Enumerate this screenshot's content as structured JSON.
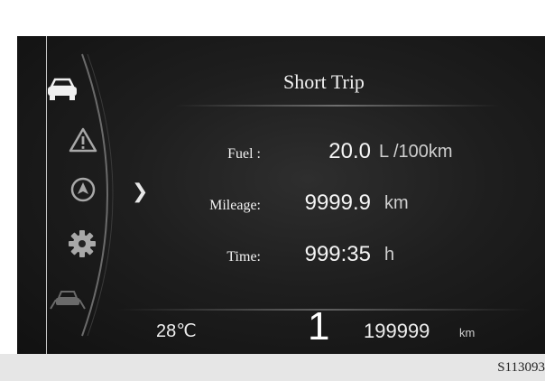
{
  "menu": {
    "items": [
      {
        "icon": "car-icon",
        "state": "selected"
      },
      {
        "icon": "warning-triangle-icon",
        "state": "idle"
      },
      {
        "icon": "navigation-icon",
        "state": "idle"
      },
      {
        "icon": "gear-settings-icon",
        "state": "idle"
      },
      {
        "icon": "car-assist-icon",
        "state": "dimmed"
      }
    ],
    "pointer_icon": "chevron-right-icon"
  },
  "trip": {
    "title": "Short Trip",
    "rows": [
      {
        "label": "Fuel :",
        "value": "20.0",
        "unit": "L /100km"
      },
      {
        "label": "Mileage:",
        "value": "9999.9",
        "unit": "km"
      },
      {
        "label": "Time:",
        "value": "999:35",
        "unit": "h"
      }
    ]
  },
  "status": {
    "temperature": "28℃",
    "gear": "1",
    "odometer_value": "199999",
    "odometer_unit": "km"
  },
  "figure_code": "S113093"
}
